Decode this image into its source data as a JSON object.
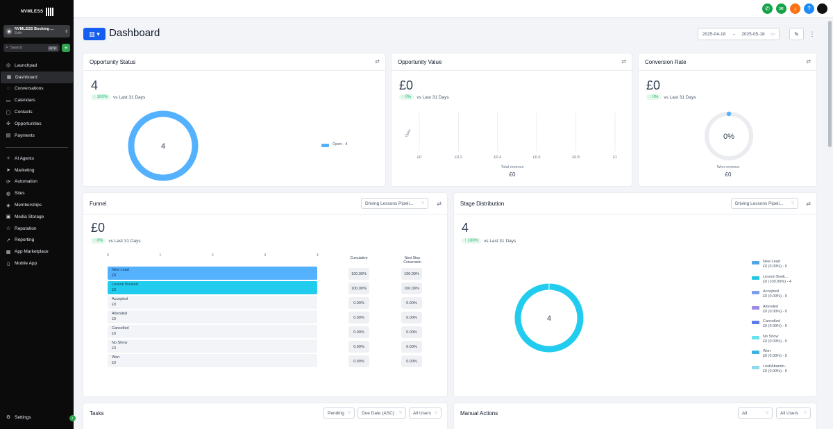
{
  "sidebar": {
    "logo_text": "NVMLESS",
    "account": {
      "name": "NVMLESS Booking ...",
      "location": "Erith"
    },
    "search": {
      "placeholder": "Search",
      "shortcut": "ctrl K"
    },
    "items": [
      {
        "label": "Launchpad",
        "icon": "rocket-icon",
        "glyph": "◎"
      },
      {
        "label": "Dashboard",
        "icon": "grid-icon",
        "glyph": "▦",
        "active": true
      },
      {
        "label": "Conversations",
        "icon": "chat-icon",
        "glyph": "◌"
      },
      {
        "label": "Calendars",
        "icon": "calendar-icon",
        "glyph": "▭"
      },
      {
        "label": "Contacts",
        "icon": "contacts-icon",
        "glyph": "▢"
      },
      {
        "label": "Opportunities",
        "icon": "opportunities-icon",
        "glyph": "✣"
      },
      {
        "label": "Payments",
        "icon": "payments-icon",
        "glyph": "▤"
      }
    ],
    "items2": [
      {
        "label": "AI Agents",
        "icon": "ai-icon",
        "glyph": "✧"
      },
      {
        "label": "Marketing",
        "icon": "send-icon",
        "glyph": "➤"
      },
      {
        "label": "Automation",
        "icon": "automation-icon",
        "glyph": "⟳"
      },
      {
        "label": "Sites",
        "icon": "globe-icon",
        "glyph": "◍"
      },
      {
        "label": "Memberships",
        "icon": "membership-icon",
        "glyph": "◈"
      },
      {
        "label": "Media Storage",
        "icon": "media-icon",
        "glyph": "▣"
      },
      {
        "label": "Reputation",
        "icon": "star-icon",
        "glyph": "☆"
      },
      {
        "label": "Reporting",
        "icon": "chart-icon",
        "glyph": "↗"
      },
      {
        "label": "App Marketplace",
        "icon": "apps-icon",
        "glyph": "▦"
      },
      {
        "label": "Mobile App",
        "icon": "mobile-icon",
        "glyph": "▯"
      }
    ],
    "settings_label": "Settings"
  },
  "topbar": {
    "icons": [
      {
        "name": "phone-icon",
        "glyph": "✆",
        "color": "#16a34a"
      },
      {
        "name": "megaphone-icon",
        "glyph": "✉",
        "color": "#16a34a"
      },
      {
        "name": "bell-icon",
        "glyph": "♪",
        "color": "#f97316"
      },
      {
        "name": "help-icon",
        "glyph": "?",
        "color": "#1d8cf8"
      },
      {
        "name": "avatar",
        "glyph": "",
        "color": "#111111"
      }
    ]
  },
  "header": {
    "title": "Dashboard",
    "date_from": "2025-04-18",
    "date_arrow": "→",
    "date_to": "2025-05-18"
  },
  "opportunity_status": {
    "title": "Opportunity Status",
    "value": "4",
    "delta": "↑ 100%",
    "delta_label": "vs Last 31 Days",
    "donut_label": "4",
    "legend": "Open - 4"
  },
  "opportunity_value": {
    "title": "Opportunity Value",
    "value": "£0",
    "delta": "↑ 0%",
    "delta_label": "vs Last 31 Days",
    "y_label": "Open",
    "x_ticks": [
      "£0",
      "£0.2",
      "£0.4",
      "£0.6",
      "£0.8",
      "£1"
    ],
    "footer_label": "Total revenue",
    "footer_value": "£0"
  },
  "conversion_rate": {
    "title": "Conversion Rate",
    "value": "£0",
    "delta": "↑ 0%",
    "delta_label": "vs Last 31 Days",
    "gauge_label": "0%",
    "footer_label": "Won revenue",
    "footer_value": "£0"
  },
  "funnel": {
    "title": "Funnel",
    "pipeline": "Driving Lessons Pipeli...",
    "value": "£0",
    "delta": "↑ 0%",
    "delta_label": "vs Last 31 Days",
    "axis": [
      "0",
      "1",
      "2",
      "3",
      "4"
    ],
    "col_cumulative": "Cumulative",
    "col_next": "Next Step Conversion",
    "rows": [
      {
        "stage": "New Lead",
        "amount": "£0",
        "cumulative": "100.00%",
        "next": "100.00%",
        "count": 4
      },
      {
        "stage": "Lesson Booked",
        "amount": "£0",
        "cumulative": "100.00%",
        "next": "100.00%",
        "count": 4
      },
      {
        "stage": "Accepted",
        "amount": "£0",
        "cumulative": "0.00%",
        "next": "0.00%",
        "count": 0
      },
      {
        "stage": "Attended",
        "amount": "£0",
        "cumulative": "0.00%",
        "next": "0.00%",
        "count": 0
      },
      {
        "stage": "Cancelled",
        "amount": "£0",
        "cumulative": "0.00%",
        "next": "0.00%",
        "count": 0
      },
      {
        "stage": "No Show",
        "amount": "£0",
        "cumulative": "0.00%",
        "next": "0.00%",
        "count": 0
      },
      {
        "stage": "Won",
        "amount": "£0",
        "cumulative": "0.00%",
        "next": "0.00%",
        "count": 0
      }
    ]
  },
  "stage_distribution": {
    "title": "Stage Distribution",
    "pipeline": "Driving Lessons Pipeli...",
    "value": "4",
    "delta": "↑ 100%",
    "delta_label": "vs Last 31 Days",
    "donut_label": "4",
    "legend": [
      {
        "name": "New Lead",
        "detail": "£0 (0.00%) - 0",
        "color": "#4ea8e6"
      },
      {
        "name": "Lesson Book...",
        "detail": "£0 (100.00%) - 4",
        "color": "#22c7e0"
      },
      {
        "name": "Accepted",
        "detail": "£0 (0.00%) - 0",
        "color": "#7c9cf0"
      },
      {
        "name": "Attended",
        "detail": "£0 (0.00%) - 0",
        "color": "#9b8be6"
      },
      {
        "name": "Cancelled",
        "detail": "£0 (0.00%) - 0",
        "color": "#5b7be9"
      },
      {
        "name": "No Show",
        "detail": "£0 (0.00%) - 0",
        "color": "#67e0ef"
      },
      {
        "name": "Won",
        "detail": "£0 (0.00%) - 0",
        "color": "#3bb3e0"
      },
      {
        "name": "Lost/Abando...",
        "detail": "£0 (0.00%) - 0",
        "color": "#8fd8ef"
      }
    ]
  },
  "tasks": {
    "title": "Tasks",
    "filter_status": "Pending",
    "filter_sort": "Due Date (ASC)",
    "filter_users": "All Users"
  },
  "manual_actions": {
    "title": "Manual Actions",
    "filter_type": "All",
    "filter_users": "All Users"
  },
  "chart_data": [
    {
      "type": "pie",
      "categories": [
        "Open"
      ],
      "values": [
        4
      ]
    },
    {
      "type": "bar",
      "categories": [
        "Open"
      ],
      "values": [
        0
      ],
      "xlim": [
        0,
        1
      ]
    },
    {
      "type": "pie",
      "categories": [
        "Won"
      ],
      "values": [
        0
      ]
    },
    {
      "type": "bar",
      "categories": [
        "New Lead",
        "Lesson Booked",
        "Accepted",
        "Attended",
        "Cancelled",
        "No Show",
        "Won"
      ],
      "values": [
        4,
        4,
        0,
        0,
        0,
        0,
        0
      ],
      "xlim": [
        0,
        4
      ]
    },
    {
      "type": "pie",
      "categories": [
        "New Lead",
        "Lesson Book...",
        "Accepted",
        "Attended",
        "Cancelled",
        "No Show",
        "Won",
        "Lost/Abando..."
      ],
      "values": [
        0,
        4,
        0,
        0,
        0,
        0,
        0,
        0
      ]
    }
  ]
}
